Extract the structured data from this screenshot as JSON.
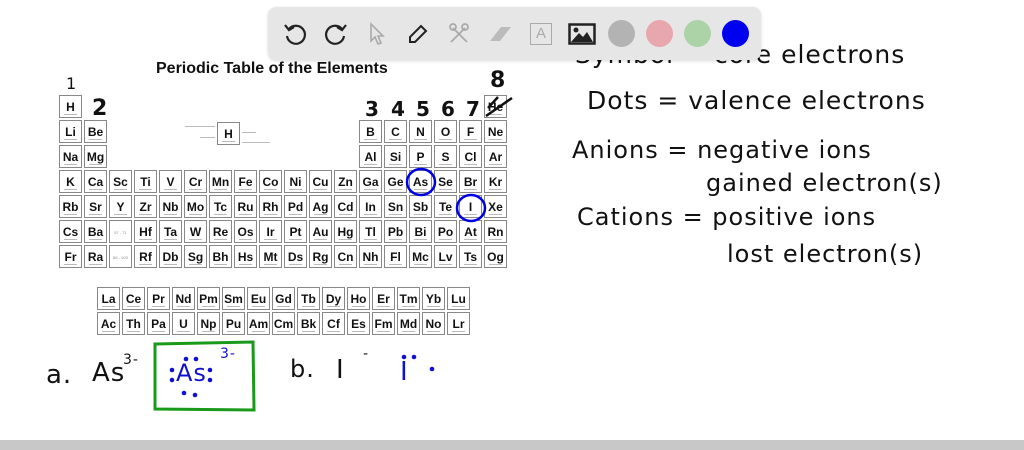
{
  "toolbar": {
    "tools": [
      "undo-icon",
      "redo-icon",
      "select-icon",
      "pen-icon",
      "tools-icon",
      "eraser-icon",
      "text-icon",
      "image-icon"
    ],
    "text_tool_glyph": "A",
    "colors": [
      "#b3b3b3",
      "#e8a7ad",
      "#acd3a8",
      "#0000f0"
    ]
  },
  "table": {
    "title": "Periodic Table of the Elements",
    "rows": [
      [
        "H",
        null,
        null,
        null,
        null,
        null,
        null,
        null,
        null,
        null,
        null,
        null,
        null,
        null,
        null,
        null,
        null,
        "He"
      ],
      [
        "Li",
        "Be",
        null,
        null,
        null,
        null,
        null,
        null,
        null,
        null,
        null,
        null,
        "B",
        "C",
        "N",
        "O",
        "F",
        "Ne"
      ],
      [
        "Na",
        "Mg",
        null,
        null,
        null,
        null,
        null,
        null,
        null,
        null,
        null,
        null,
        "Al",
        "Si",
        "P",
        "S",
        "Cl",
        "Ar"
      ],
      [
        "K",
        "Ca",
        "Sc",
        "Ti",
        "V",
        "Cr",
        "Mn",
        "Fe",
        "Co",
        "Ni",
        "Cu",
        "Zn",
        "Ga",
        "Ge",
        "As",
        "Se",
        "Br",
        "Kr"
      ],
      [
        "Rb",
        "Sr",
        "Y",
        "Zr",
        "Nb",
        "Mo",
        "Tc",
        "Ru",
        "Rh",
        "Pd",
        "Ag",
        "Cd",
        "In",
        "Sn",
        "Sb",
        "Te",
        "I",
        "Xe"
      ],
      [
        "Cs",
        "Ba",
        "57 - 71",
        "Hf",
        "Ta",
        "W",
        "Re",
        "Os",
        "Ir",
        "Pt",
        "Au",
        "Hg",
        "Tl",
        "Pb",
        "Bi",
        "Po",
        "At",
        "Rn"
      ],
      [
        "Fr",
        "Ra",
        "89 - 103",
        "Rf",
        "Db",
        "Sg",
        "Bh",
        "Hs",
        "Mt",
        "Ds",
        "Rg",
        "Cn",
        "Nh",
        "Fl",
        "Mc",
        "Lv",
        "Ts",
        "Og"
      ]
    ],
    "lanthanides": [
      "La",
      "Ce",
      "Pr",
      "Nd",
      "Pm",
      "Sm",
      "Eu",
      "Gd",
      "Tb",
      "Dy",
      "Ho",
      "Er",
      "Tm",
      "Yb",
      "Lu"
    ],
    "actinides": [
      "Ac",
      "Th",
      "Pa",
      "U",
      "Np",
      "Pu",
      "Am",
      "Cm",
      "Bk",
      "Cf",
      "Es",
      "Fm",
      "Md",
      "No",
      "Lr"
    ],
    "legend_symbol": "H"
  },
  "annotations": {
    "g1": "1",
    "g2": "2",
    "g3": "3",
    "g4": "4",
    "g5": "5",
    "g6": "6",
    "g7": "7",
    "g8": "8"
  },
  "notes": {
    "line1": "Symbol = core electrons",
    "line2": "Dots = valence electrons",
    "line3": "Anions = negative ions",
    "line4": "gained electron(s)",
    "line5": "Cations = positive ions",
    "line6": "lost electron(s)"
  },
  "problems": {
    "a_label": "a.",
    "a_ion": "As",
    "a_charge": "3-",
    "a_answer": "As",
    "a_answer_charge": "3-",
    "b_label": "b.",
    "b_ion": "I",
    "b_charge": "-",
    "b_answer": "I"
  }
}
